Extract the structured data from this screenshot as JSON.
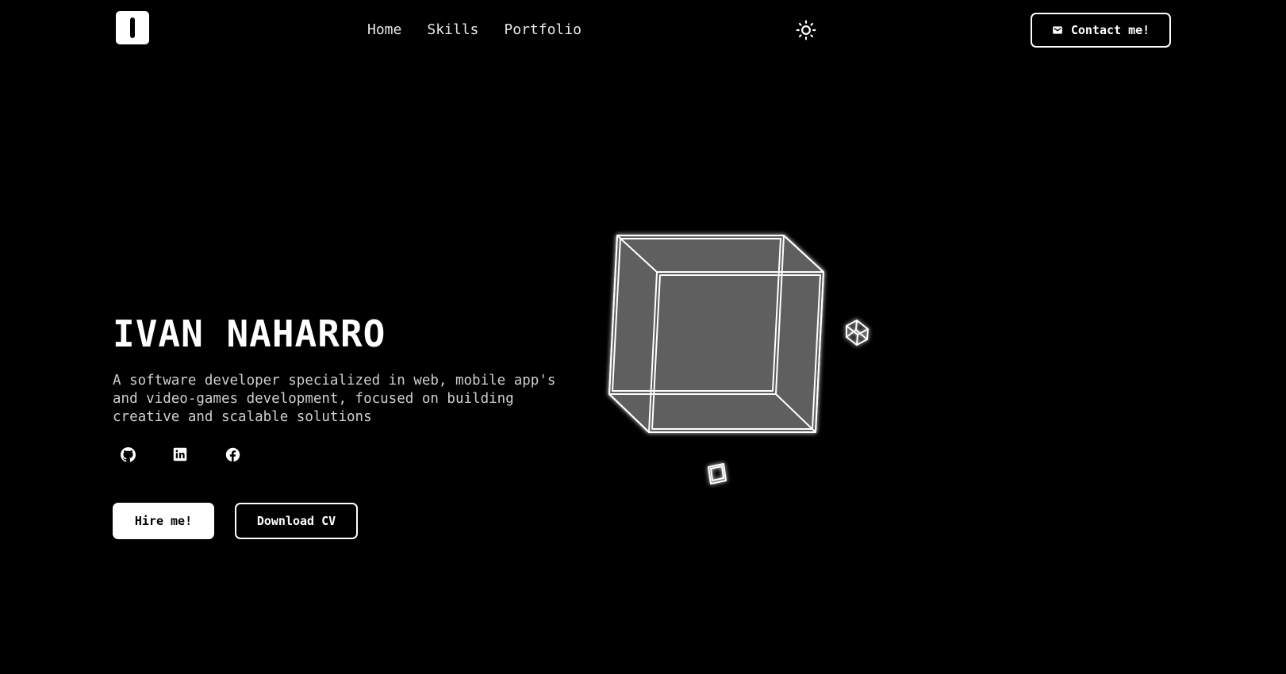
{
  "header": {
    "logo_icon": "logo-bar-icon",
    "nav": [
      {
        "label": "Home"
      },
      {
        "label": "Skills"
      },
      {
        "label": "Portfolio"
      }
    ],
    "theme_icon": "sun-icon",
    "contact": {
      "label": "Contact me!",
      "icon": "mail-icon"
    }
  },
  "hero": {
    "name": "IVAN NAHARRO",
    "description": "A software developer specialized in web, mobile app's and video-games development, focused on building creative and scalable solutions",
    "socials": [
      {
        "icon": "github-icon"
      },
      {
        "icon": "linkedin-icon"
      },
      {
        "icon": "facebook-icon"
      }
    ],
    "primary_button": "Hire me!",
    "secondary_button": "Download CV"
  },
  "colors": {
    "background": "#000000",
    "foreground": "#ffffff",
    "muted_text": "#cfcfcf",
    "cube_fill": "#5e5e5e"
  }
}
